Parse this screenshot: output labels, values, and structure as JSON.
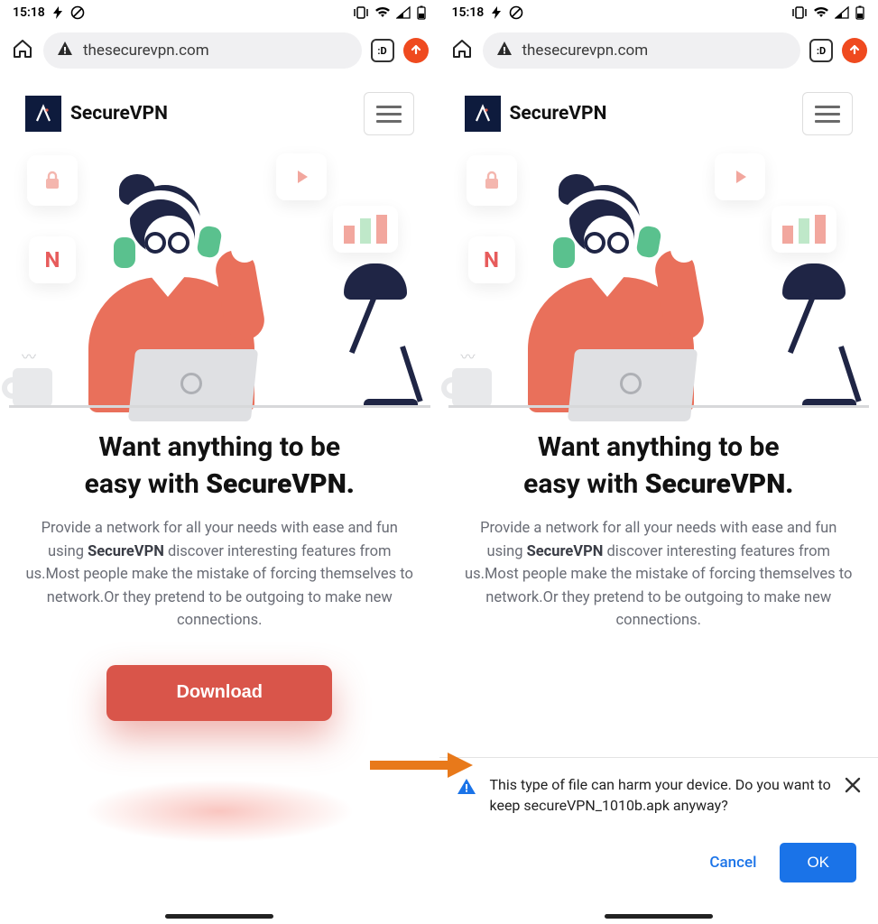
{
  "statusbar": {
    "time": "15:18"
  },
  "browser": {
    "url": "thesecurevpn.com"
  },
  "brand": {
    "name": "SecureVPN",
    "netflix_glyph": "N"
  },
  "headline": {
    "line1": "Want anything to be",
    "line2_prefix": "easy with ",
    "line2_bold": "SecureVPN."
  },
  "paragraph": {
    "p1a": "Provide a network for all your needs with ease and fun using ",
    "p1b": "SecureVPN",
    "p1c": " discover interesting features from us.Most people make the mistake of forcing themselves to network.Or they pretend to be outgoing to make new connections."
  },
  "cta": {
    "download": "Download"
  },
  "prompt": {
    "text": "This type of file can harm your device. Do you want to keep secureVPN_1010b.apk anyway?",
    "cancel": "Cancel",
    "ok": "OK"
  }
}
